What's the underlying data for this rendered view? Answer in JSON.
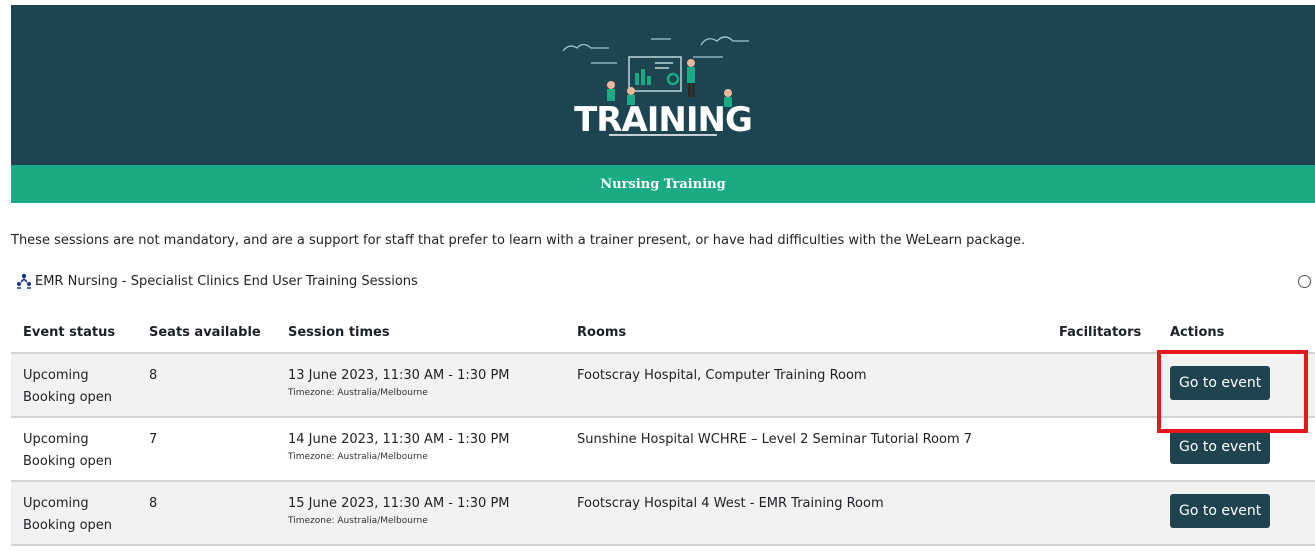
{
  "banner": {
    "logo_text": "TRAINING",
    "colors": {
      "background": "#1c4451",
      "accent": "#1aab84"
    }
  },
  "section": {
    "title": "Nursing Training"
  },
  "intro_text": "These sessions are not mandatory, and are a support for staff that prefer to learn with a trainer present, or have had difficulties with the WeLearn package.",
  "course": {
    "icon": "seminar-activity-icon",
    "title": "EMR Nursing - Specialist Clinics End User Training Sessions"
  },
  "table": {
    "headers": {
      "event_status": "Event status",
      "seats": "Seats available",
      "session_times": "Session times",
      "rooms": "Rooms",
      "facilitators": "Facilitators",
      "actions": "Actions"
    },
    "rows": [
      {
        "status_line1": "Upcoming",
        "status_line2": "Booking open",
        "seats": "8",
        "time": "13 June 2023, 11:30 AM - 1:30 PM",
        "timezone": "Timezone: Australia/Melbourne",
        "room": "Footscray Hospital, Computer Training Room",
        "facilitators": "",
        "action_label": "Go to event"
      },
      {
        "status_line1": "Upcoming",
        "status_line2": "Booking open",
        "seats": "7",
        "time": "14 June 2023, 11:30 AM - 1:30 PM",
        "timezone": "Timezone: Australia/Melbourne",
        "room": "Sunshine Hospital WCHRE – Level 2 Seminar Tutorial Room 7",
        "facilitators": "",
        "action_label": "Go to event"
      },
      {
        "status_line1": "Upcoming",
        "status_line2": "Booking open",
        "seats": "8",
        "time": "15 June 2023, 11:30 AM - 1:30 PM",
        "timezone": "Timezone: Australia/Melbourne",
        "room": "Footscray Hospital 4 West - EMR Training Room",
        "facilitators": "",
        "action_label": "Go to event"
      }
    ]
  },
  "annotation": {
    "highlight_color": "#e8161d"
  }
}
